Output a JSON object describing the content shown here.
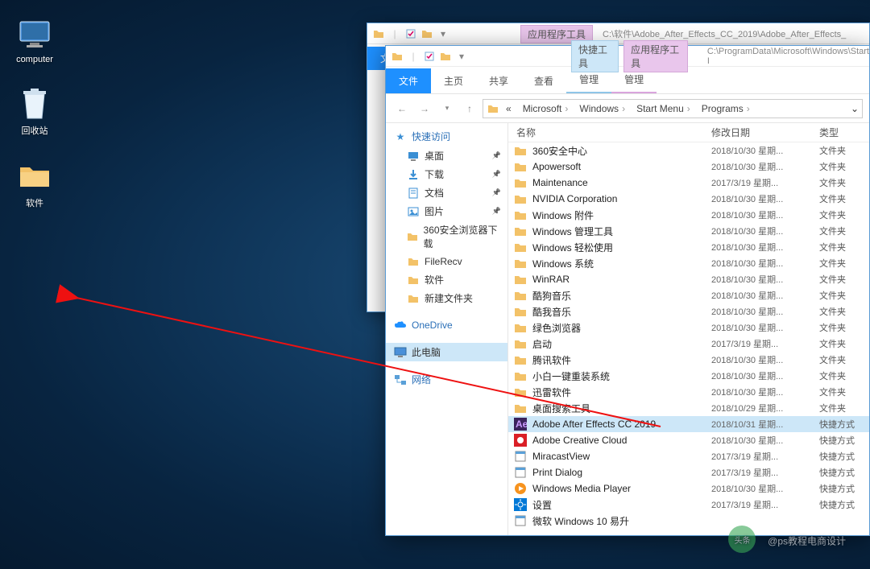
{
  "desktop": {
    "icons": [
      {
        "name": "computer",
        "label": "computer"
      },
      {
        "name": "recycle",
        "label": "回收站"
      },
      {
        "name": "softfolder",
        "label": "软件"
      }
    ]
  },
  "back_window": {
    "context_tab": "应用程序工具",
    "path_title": "C:\\软件\\Adobe_After_Effects_CC_2019\\Adobe_After_Effects_",
    "file_tab": "文",
    "tabs": []
  },
  "front_window": {
    "context_tabs": [
      "快捷工具",
      "应用程序工具"
    ],
    "path_title": "C:\\ProgramData\\Microsoft\\Windows\\Start I",
    "file_tab": "文件",
    "tabs": [
      "主页",
      "共享",
      "查看"
    ],
    "context_tab_labels": [
      "管理",
      "管理"
    ],
    "breadcrumbs_prefix": "«",
    "breadcrumbs": [
      "Microsoft",
      "Windows",
      "Start Menu",
      "Programs"
    ],
    "columns": {
      "name": "名称",
      "date": "修改日期",
      "type": "类型"
    }
  },
  "sidebar": {
    "quick_access": "快速访问",
    "items": [
      {
        "label": "桌面",
        "icon": "desktop",
        "pinned": true
      },
      {
        "label": "下载",
        "icon": "download",
        "pinned": true
      },
      {
        "label": "文档",
        "icon": "document",
        "pinned": true
      },
      {
        "label": "图片",
        "icon": "picture",
        "pinned": true
      },
      {
        "label": "360安全浏览器下载",
        "icon": "folder"
      },
      {
        "label": "FileRecv",
        "icon": "folder"
      },
      {
        "label": "软件",
        "icon": "folder"
      },
      {
        "label": "新建文件夹",
        "icon": "folder"
      }
    ],
    "onedrive": "OneDrive",
    "this_pc": "此电脑",
    "network": "网络"
  },
  "files": [
    {
      "name": "360安全中心",
      "date": "2018/10/30 星期...",
      "type": "文件夹",
      "kind": "folder"
    },
    {
      "name": "Apowersoft",
      "date": "2018/10/30 星期...",
      "type": "文件夹",
      "kind": "folder"
    },
    {
      "name": "Maintenance",
      "date": "2017/3/19 星期...",
      "type": "文件夹",
      "kind": "folder"
    },
    {
      "name": "NVIDIA Corporation",
      "date": "2018/10/30 星期...",
      "type": "文件夹",
      "kind": "folder"
    },
    {
      "name": "Windows 附件",
      "date": "2018/10/30 星期...",
      "type": "文件夹",
      "kind": "folder"
    },
    {
      "name": "Windows 管理工具",
      "date": "2018/10/30 星期...",
      "type": "文件夹",
      "kind": "folder"
    },
    {
      "name": "Windows 轻松使用",
      "date": "2018/10/30 星期...",
      "type": "文件夹",
      "kind": "folder"
    },
    {
      "name": "Windows 系统",
      "date": "2018/10/30 星期...",
      "type": "文件夹",
      "kind": "folder"
    },
    {
      "name": "WinRAR",
      "date": "2018/10/30 星期...",
      "type": "文件夹",
      "kind": "folder"
    },
    {
      "name": "酷狗音乐",
      "date": "2018/10/30 星期...",
      "type": "文件夹",
      "kind": "folder"
    },
    {
      "name": "酷我音乐",
      "date": "2018/10/30 星期...",
      "type": "文件夹",
      "kind": "folder"
    },
    {
      "name": "绿色浏览器",
      "date": "2018/10/30 星期...",
      "type": "文件夹",
      "kind": "folder"
    },
    {
      "name": "启动",
      "date": "2017/3/19 星期...",
      "type": "文件夹",
      "kind": "folder"
    },
    {
      "name": "腾讯软件",
      "date": "2018/10/30 星期...",
      "type": "文件夹",
      "kind": "folder"
    },
    {
      "name": "小白一键重装系统",
      "date": "2018/10/30 星期...",
      "type": "文件夹",
      "kind": "folder"
    },
    {
      "name": "迅雷软件",
      "date": "2018/10/30 星期...",
      "type": "文件夹",
      "kind": "folder"
    },
    {
      "name": "桌面搜索工具",
      "date": "2018/10/29 星期...",
      "type": "文件夹",
      "kind": "folder"
    },
    {
      "name": "Adobe After Effects CC 2019",
      "date": "2018/10/31 星期...",
      "type": "快捷方式",
      "kind": "ae",
      "selected": true
    },
    {
      "name": "Adobe Creative Cloud",
      "date": "2018/10/30 星期...",
      "type": "快捷方式",
      "kind": "cc"
    },
    {
      "name": "MiracastView",
      "date": "2017/3/19 星期...",
      "type": "快捷方式",
      "kind": "app"
    },
    {
      "name": "Print Dialog",
      "date": "2017/3/19 星期...",
      "type": "快捷方式",
      "kind": "app"
    },
    {
      "name": "Windows Media Player",
      "date": "2018/10/30 星期...",
      "type": "快捷方式",
      "kind": "wmp"
    },
    {
      "name": "设置",
      "date": "2017/3/19 星期...",
      "type": "快捷方式",
      "kind": "settings"
    },
    {
      "name": "微软 Windows 10 易升",
      "date": "",
      "type": "",
      "kind": "app"
    }
  ],
  "watermark": "@ps教程电商设计",
  "watermark_prefix": "头条"
}
